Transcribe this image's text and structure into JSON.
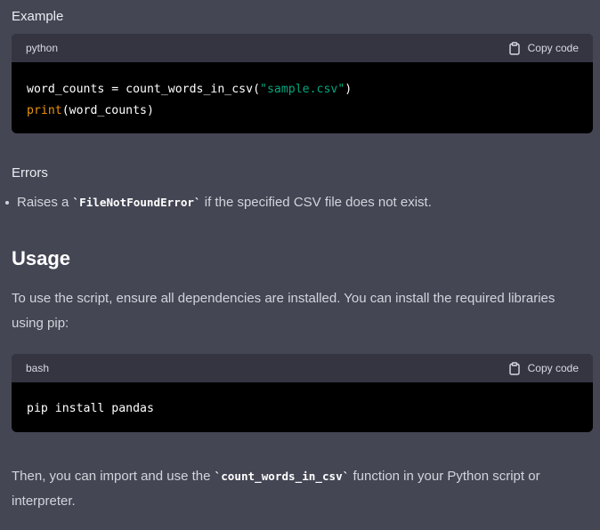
{
  "example_heading": "Example",
  "code_blocks": [
    {
      "language": "python",
      "copy_label": "Copy code",
      "lines": [
        {
          "plain1": "word_counts = count_words_in_csv(",
          "string": "\"sample.csv\"",
          "plain2": ")"
        },
        {
          "fn": "print",
          "rest": "(word_counts)"
        }
      ]
    },
    {
      "language": "bash",
      "copy_label": "Copy code",
      "line": "pip install pandas"
    }
  ],
  "errors_heading": "Errors",
  "errors_bullet": {
    "prefix": "Raises a ",
    "code": "`FileNotFoundError`",
    "suffix": " if the specified CSV file does not exist."
  },
  "usage_heading": "Usage",
  "usage_paragraph": {
    "line1": "To use the script, ensure all dependencies are installed. You can install the required libraries",
    "line2": "using pip:"
  },
  "final_paragraph": {
    "prefix": "Then, you can import and use the ",
    "code": "`count_words_in_csv`",
    "suffix": " function in your Python script or",
    "line2": "interpreter."
  },
  "icons": {
    "copy": "clipboard-icon"
  },
  "colors": {
    "background": "#444654",
    "code_header": "#343541",
    "code_body": "#000000",
    "string_token": "#00a67d",
    "function_token": "#e9950c"
  }
}
